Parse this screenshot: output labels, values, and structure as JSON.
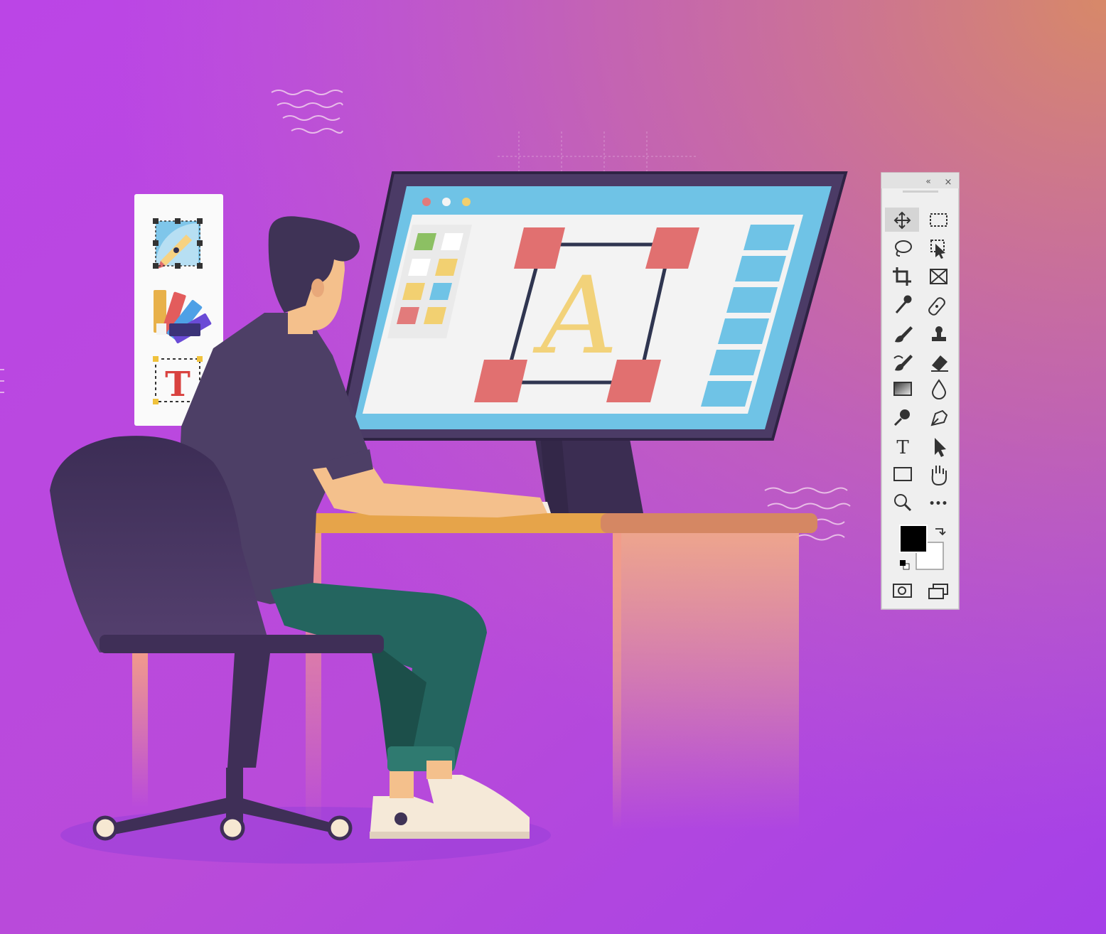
{
  "scene": {
    "screen_letter": "A",
    "left_panel": {
      "items": [
        {
          "name": "pen-tool-card-icon"
        },
        {
          "name": "color-swatches-icon"
        },
        {
          "name": "text-box-icon",
          "glyph": "T"
        }
      ]
    },
    "toolbox": {
      "header_glyphs": [
        "«",
        "×"
      ],
      "tools": [
        [
          "move",
          "marquee"
        ],
        [
          "lasso",
          "object-select"
        ],
        [
          "crop",
          "frame"
        ],
        [
          "eyedropper",
          "healing"
        ],
        [
          "brush",
          "stamp"
        ],
        [
          "history-brush",
          "eraser"
        ],
        [
          "gradient",
          "blur"
        ],
        [
          "dodge",
          "pen"
        ],
        [
          "type",
          "path-select"
        ],
        [
          "rectangle",
          "hand"
        ],
        [
          "zoom",
          "more"
        ]
      ],
      "type_glyph": "T",
      "more_glyph": "•••",
      "foreground_color": "#000000",
      "background_color": "#ffffff",
      "bottom": [
        "quick-mask",
        "screen-mode"
      ]
    },
    "colors": {
      "bg_top_left": "#b94ee0",
      "bg_top_right": "#d2836a",
      "bg_bottom": "#a03fe6",
      "monitor_frame": "#4b3b66",
      "screen_titlebar": "#6fc3e6",
      "screen_canvas": "#f2f2f2",
      "handles": "#e17070",
      "letter": "#f2d27a",
      "person_shirt": "#4d3f66",
      "person_pants": "#24655f",
      "skin": "#f4c08c",
      "desk_top": "#e6a44a",
      "chair": "#3f2f57"
    }
  }
}
